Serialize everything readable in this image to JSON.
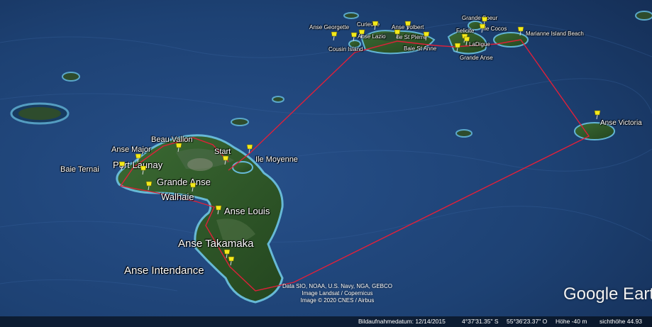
{
  "colors": {
    "ocean": "#1d4173",
    "land": "#2f5a2a",
    "route": "#e0203a",
    "pin": "#f3ea1b"
  },
  "places": [
    {
      "id": "anse-georgette",
      "label": "Anse Georgette",
      "size": "small"
    },
    {
      "id": "curieuse",
      "label": "Curieuse",
      "size": "small"
    },
    {
      "id": "anse-volbert",
      "label": "Anse Volbert",
      "size": "small"
    },
    {
      "id": "anse-lazio",
      "label": "Anse Lazio",
      "size": "small"
    },
    {
      "id": "ile-st-pierre",
      "label": "Ile St Pierre",
      "size": "small"
    },
    {
      "id": "cousin-island",
      "label": "Cousin Island",
      "size": "small"
    },
    {
      "id": "baie-st-anne",
      "label": "Baie St Anne",
      "size": "small"
    },
    {
      "id": "grande-soeur",
      "label": "Grande Soeur",
      "size": "small"
    },
    {
      "id": "felicite",
      "label": "Felicite",
      "size": "small"
    },
    {
      "id": "ile-cocos",
      "label": "Ile Cocos",
      "size": "small"
    },
    {
      "id": "ladigue",
      "label": "LaDigue",
      "size": "small"
    },
    {
      "id": "grande-anse-ladigue",
      "label": "Grande Anse",
      "size": "small"
    },
    {
      "id": "marianne-island-beach",
      "label": "Marianne Island Beach",
      "size": "small"
    },
    {
      "id": "anse-victoria",
      "label": "Anse Victoria",
      "size": "medium"
    },
    {
      "id": "beau-vallon",
      "label": "Beau Vallon",
      "size": "medium"
    },
    {
      "id": "anse-major",
      "label": "Anse Major",
      "size": "medium"
    },
    {
      "id": "port-launay",
      "label": "Port Launay",
      "size": "large"
    },
    {
      "id": "baie-ternai",
      "label": "Baie Ternai",
      "size": "medium"
    },
    {
      "id": "start",
      "label": "Start",
      "size": "medium"
    },
    {
      "id": "ile-moyenne",
      "label": "Ile Moyenne",
      "size": "medium"
    },
    {
      "id": "grande-anse",
      "label": "Grande Anse",
      "size": "large"
    },
    {
      "id": "walhaie",
      "label": "Walhaie",
      "size": "large"
    },
    {
      "id": "anse-louis",
      "label": "Anse Louis",
      "size": "large"
    },
    {
      "id": "anse-takamaka",
      "label": "Anse Takamaka",
      "size": "xlarge"
    },
    {
      "id": "anse-intendance",
      "label": "Anse Intendance",
      "size": "xlarge"
    }
  ],
  "attribution": {
    "line1": "Data SIO, NOAA, U.S. Navy, NGA, GEBCO",
    "line2": "Image Landsat / Copernicus",
    "line3": "Image © 2020 CNES / Airbus"
  },
  "logo": "Google Earth",
  "status": {
    "date_label": "Bildaufnahmedatum: 12/14/2015",
    "latitude": "4°37'31.35\" S",
    "longitude": "55°36'23.37\" O",
    "elevation": "Höhe   -40 m",
    "eye_altitude": "sichthöhe  44.93"
  }
}
